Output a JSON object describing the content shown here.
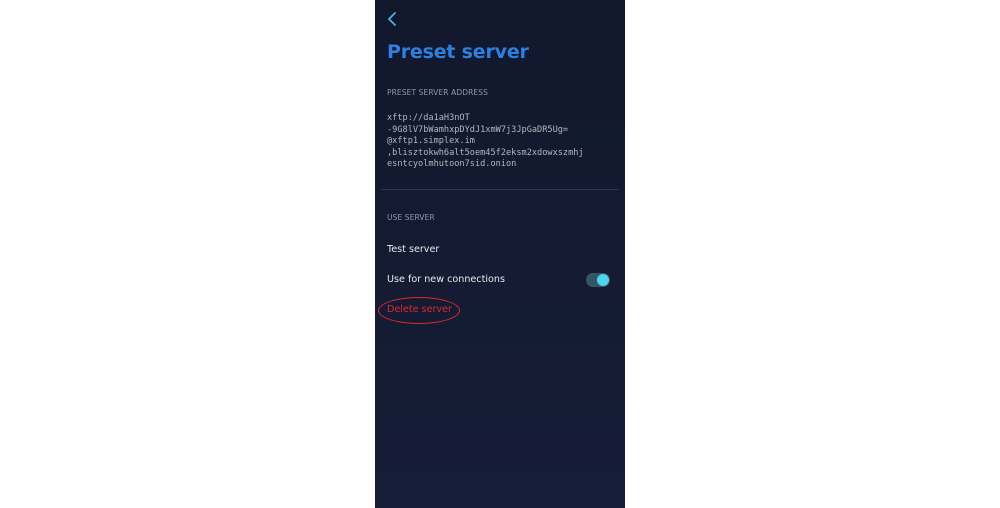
{
  "header": {
    "back_icon": "chevron-left-icon",
    "title": "Preset server"
  },
  "address_section": {
    "header": "PRESET SERVER ADDRESS",
    "address": "xftp://da1aH3nOT\n-9G8lV7bWamhxpDYdJ1xmW7j3JpGaDR5Ug=\n@xftp1.simplex.im\n,blisztokwh6alt5oem45f2eksm2xdowxszmhj\nesntcyolmhutoon7sid.onion"
  },
  "use_section": {
    "header": "USE SERVER",
    "test_label": "Test server",
    "use_new_label": "Use for new connections",
    "use_new_enabled": true,
    "delete_label": "Delete server"
  },
  "colors": {
    "title": "#2f7fe0",
    "delete": "#e0282e",
    "toggle_knob": "#4fd2ee",
    "background": "#141b33"
  }
}
